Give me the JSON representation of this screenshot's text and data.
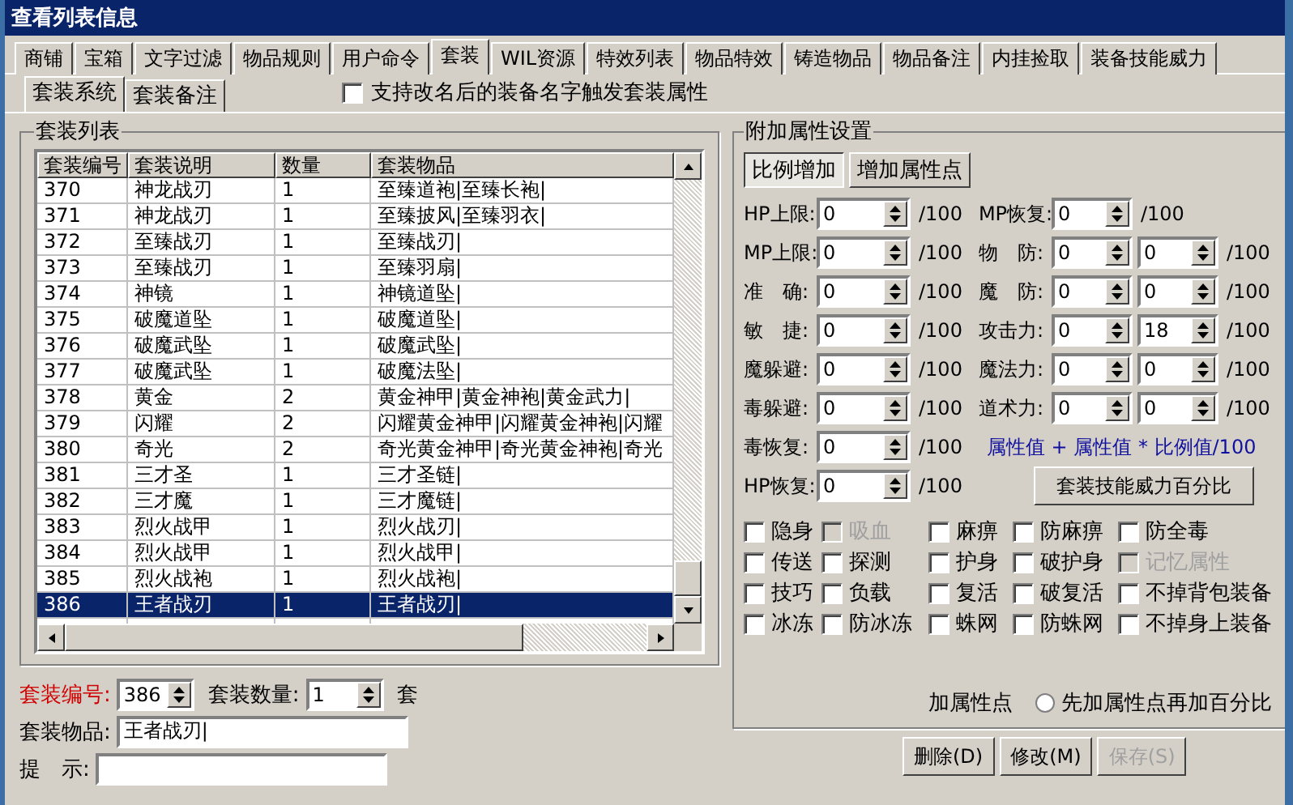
{
  "window": {
    "title": "查看列表信息"
  },
  "tabs": [
    {
      "label": "商铺",
      "selected": false
    },
    {
      "label": "宝箱",
      "selected": false
    },
    {
      "label": "文字过滤",
      "selected": false
    },
    {
      "label": "物品规则",
      "selected": false
    },
    {
      "label": "用户命令",
      "selected": false
    },
    {
      "label": "套装",
      "selected": true
    },
    {
      "label": "WIL资源",
      "selected": false
    },
    {
      "label": "特效列表",
      "selected": false
    },
    {
      "label": "物品特效",
      "selected": false
    },
    {
      "label": "铸造物品",
      "selected": false
    },
    {
      "label": "物品备注",
      "selected": false
    },
    {
      "label": "内挂捡取",
      "selected": false
    },
    {
      "label": "装备技能威力",
      "selected": false
    }
  ],
  "subtabs": [
    {
      "label": "套装系统",
      "selected": true
    },
    {
      "label": "套装备注",
      "selected": false
    }
  ],
  "rename_option": {
    "label": "支持改名后的装备名字触发套装属性",
    "checked": false
  },
  "suit_list": {
    "title": "套装列表",
    "columns": [
      "套装编号",
      "套装说明",
      "数量",
      "套装物品"
    ],
    "rows": [
      {
        "cells": [
          "370",
          "神龙战刃",
          "1",
          "至臻道袍|至臻长袍|"
        ],
        "selected": false
      },
      {
        "cells": [
          "371",
          "神龙战刃",
          "1",
          "至臻披风|至臻羽衣|"
        ],
        "selected": false
      },
      {
        "cells": [
          "372",
          "至臻战刃",
          "1",
          "至臻战刃|"
        ],
        "selected": false
      },
      {
        "cells": [
          "373",
          "至臻战刃",
          "1",
          "至臻羽扇|"
        ],
        "selected": false
      },
      {
        "cells": [
          "374",
          "神镜",
          "1",
          "神镜道坠|"
        ],
        "selected": false
      },
      {
        "cells": [
          "375",
          "破魔道坠",
          "1",
          "破魔道坠|"
        ],
        "selected": false
      },
      {
        "cells": [
          "376",
          "破魔武坠",
          "1",
          "破魔武坠|"
        ],
        "selected": false
      },
      {
        "cells": [
          "377",
          "破魔武坠",
          "1",
          "破魔法坠|"
        ],
        "selected": false
      },
      {
        "cells": [
          "378",
          "黄金",
          "2",
          "黄金神甲|黄金神袍|黄金武力|"
        ],
        "selected": false
      },
      {
        "cells": [
          "379",
          "闪耀",
          "2",
          "闪耀黄金神甲|闪耀黄金神袍|闪耀"
        ],
        "selected": false
      },
      {
        "cells": [
          "380",
          "奇光",
          "2",
          "奇光黄金神甲|奇光黄金神袍|奇光"
        ],
        "selected": false
      },
      {
        "cells": [
          "381",
          "三才圣",
          "1",
          "三才圣链|"
        ],
        "selected": false
      },
      {
        "cells": [
          "382",
          "三才魔",
          "1",
          "三才魔链|"
        ],
        "selected": false
      },
      {
        "cells": [
          "383",
          "烈火战甲",
          "1",
          "烈火战刃|"
        ],
        "selected": false
      },
      {
        "cells": [
          "384",
          "烈火战甲",
          "1",
          "烈火战甲|"
        ],
        "selected": false
      },
      {
        "cells": [
          "385",
          "烈火战袍",
          "1",
          "烈火战袍|"
        ],
        "selected": false
      },
      {
        "cells": [
          "386",
          "王者战刃",
          "1",
          "王者战刃|"
        ],
        "selected": true
      }
    ]
  },
  "suit_form": {
    "id": {
      "label": "套装编号:",
      "value": "386"
    },
    "count": {
      "label": "套装数量:",
      "value": "1"
    },
    "cut_label": "套",
    "items": {
      "label": "套装物品:",
      "value": "王者战刃|"
    },
    "hint": {
      "label": "提　示:"
    }
  },
  "attr_panel": {
    "title": "附加属性设置",
    "modes": [
      {
        "label": "比例增加",
        "selected": true
      },
      {
        "label": "增加属性点",
        "selected": false
      }
    ],
    "left_fields": [
      {
        "label": "HP上限:",
        "value": "0",
        "suffix": "/100"
      },
      {
        "label": "MP上限:",
        "value": "0",
        "suffix": "/100"
      },
      {
        "label": "准　确:",
        "value": "0",
        "suffix": "/100"
      },
      {
        "label": "敏　捷:",
        "value": "0",
        "suffix": "/100"
      },
      {
        "label": "魔躲避:",
        "value": "0",
        "suffix": "/100"
      },
      {
        "label": "毒躲避:",
        "value": "0",
        "suffix": "/100"
      },
      {
        "label": "毒恢复:",
        "value": "0",
        "suffix": "/100"
      },
      {
        "label": "HP恢复:",
        "value": "0",
        "suffix": "/100"
      }
    ],
    "right_fields": [
      {
        "label": "MP恢复:",
        "values": [
          "0"
        ],
        "suffix": "/100"
      },
      {
        "label": "物　防:",
        "values": [
          "0",
          "0"
        ],
        "suffix": "/100"
      },
      {
        "label": "魔　防:",
        "values": [
          "0",
          "0"
        ],
        "suffix": "/100"
      },
      {
        "label": "攻击力:",
        "values": [
          "0",
          "18"
        ],
        "suffix": "/100"
      },
      {
        "label": "魔法力:",
        "values": [
          "0",
          "0"
        ],
        "suffix": "/100"
      },
      {
        "label": "道术力:",
        "values": [
          "0",
          "0"
        ],
        "suffix": "/100"
      }
    ],
    "formula": "属性值 + 属性值 * 比例值/100",
    "skill_button": "套装技能威力百分比",
    "flags": [
      {
        "label": "隐身",
        "checked": false,
        "disabled": false
      },
      {
        "label": "吸血",
        "checked": false,
        "disabled": true
      },
      {
        "label": "麻痹",
        "checked": false,
        "disabled": false
      },
      {
        "label": "防麻痹",
        "checked": false,
        "disabled": false
      },
      {
        "label": "防全毒",
        "checked": false,
        "disabled": false
      },
      {
        "label": "传送",
        "checked": false,
        "disabled": false
      },
      {
        "label": "探测",
        "checked": false,
        "disabled": false
      },
      {
        "label": "护身",
        "checked": false,
        "disabled": false
      },
      {
        "label": "破护身",
        "checked": false,
        "disabled": false
      },
      {
        "label": "记忆属性",
        "checked": false,
        "disabled": true
      },
      {
        "label": "技巧",
        "checked": false,
        "disabled": false
      },
      {
        "label": "负载",
        "checked": false,
        "disabled": false
      },
      {
        "label": "复活",
        "checked": false,
        "disabled": false
      },
      {
        "label": "破复活",
        "checked": false,
        "disabled": false
      },
      {
        "label": "不掉背包装备",
        "checked": false,
        "disabled": false
      },
      {
        "label": "冰冻",
        "checked": false,
        "disabled": false
      },
      {
        "label": "防冰冻",
        "checked": false,
        "disabled": false
      },
      {
        "label": "蛛网",
        "checked": false,
        "disabled": false
      },
      {
        "label": "防蛛网",
        "checked": false,
        "disabled": false
      },
      {
        "label": "不掉身上装备",
        "checked": false,
        "disabled": false
      }
    ],
    "cut_radio_label": "加属性点",
    "radio": {
      "label": "先加属性点再加百分比",
      "selected": false
    }
  },
  "buttons": [
    {
      "label": "删除(D)",
      "disabled": false
    },
    {
      "label": "修改(M)",
      "disabled": false
    },
    {
      "label": "保存(S)",
      "disabled": true
    }
  ]
}
